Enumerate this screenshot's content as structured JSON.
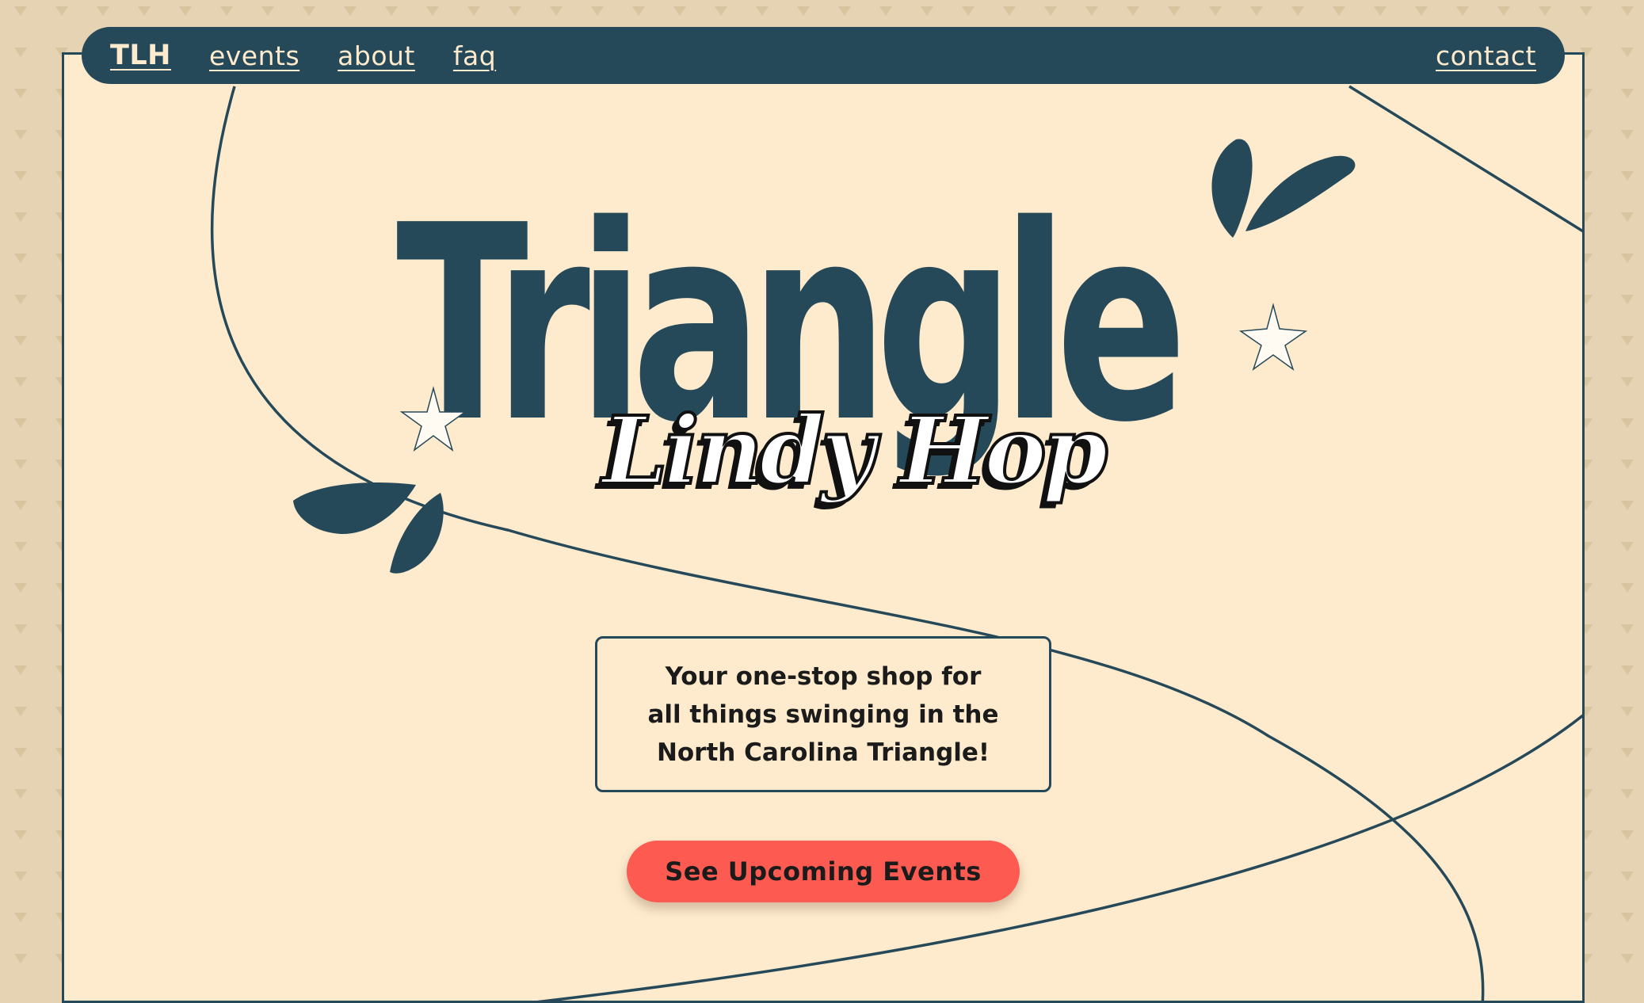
{
  "nav": {
    "brand": "TLH",
    "links": [
      "events",
      "about",
      "faq"
    ],
    "contact": "contact"
  },
  "hero": {
    "title": "Triangle",
    "subtitle": "Lindy Hop"
  },
  "tagline": {
    "lines": [
      "Your one-stop shop for",
      "all things swinging in the",
      "North Carolina Triangle!"
    ]
  },
  "cta": {
    "label": "See Upcoming Events"
  },
  "colors": {
    "background": "#e6d3b3",
    "panel": "#feebcd",
    "navy": "#26495a",
    "coral": "#fd5b52",
    "text": "#1b1b1b"
  },
  "icons": [
    "star-icon",
    "leaf-icon"
  ]
}
